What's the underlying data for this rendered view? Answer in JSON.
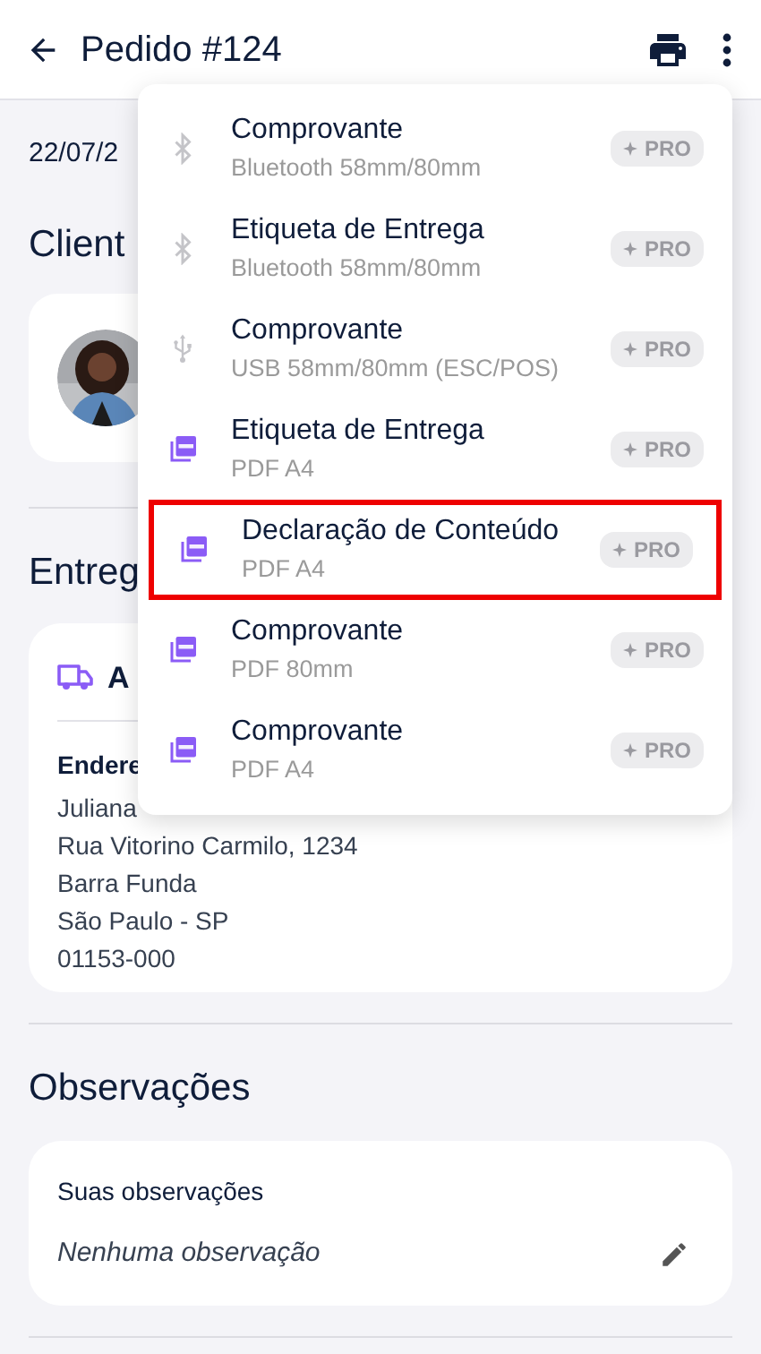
{
  "header": {
    "title": "Pedido #124"
  },
  "order": {
    "date": "22/07/2"
  },
  "client": {
    "heading": "Client"
  },
  "delivery": {
    "heading": "Entreg",
    "method": "A",
    "address_label": "Endere",
    "address_lines": [
      "Juliana",
      "Rua Vitorino Carmilo, 1234",
      "Barra Funda",
      "São Paulo - SP",
      "01153-000"
    ]
  },
  "notes": {
    "heading": "Observações",
    "label": "Suas observações",
    "value": "Nenhuma observação"
  },
  "print_menu": {
    "items": [
      {
        "kind": "bluetooth",
        "title": "Comprovante",
        "subtitle": "Bluetooth 58mm/80mm",
        "badge": "PRO",
        "highlighted": false
      },
      {
        "kind": "bluetooth",
        "title": "Etiqueta de Entrega",
        "subtitle": "Bluetooth 58mm/80mm",
        "badge": "PRO",
        "highlighted": false
      },
      {
        "kind": "usb",
        "title": "Comprovante",
        "subtitle": "USB 58mm/80mm (ESC/POS)",
        "badge": "PRO",
        "highlighted": false
      },
      {
        "kind": "pdf",
        "title": "Etiqueta de Entrega",
        "subtitle": "PDF A4",
        "badge": "PRO",
        "highlighted": false
      },
      {
        "kind": "pdf",
        "title": "Declaração de Conteúdo",
        "subtitle": "PDF A4",
        "badge": "PRO",
        "highlighted": true
      },
      {
        "kind": "pdf",
        "title": "Comprovante",
        "subtitle": "PDF 80mm",
        "badge": "PRO",
        "highlighted": false
      },
      {
        "kind": "pdf",
        "title": "Comprovante",
        "subtitle": "PDF A4",
        "badge": "PRO",
        "highlighted": false
      }
    ]
  }
}
